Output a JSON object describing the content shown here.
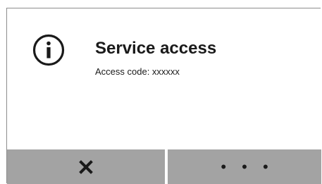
{
  "dialog": {
    "icon": "info-circle-icon",
    "title": "Service access",
    "subtitle": "Access code: xxxxxx"
  },
  "buttons": {
    "cancel_icon": "close-x-icon",
    "more_label": "• • •"
  },
  "colors": {
    "button_background": "#a3a3a3",
    "text": "#1a1a1a",
    "border": "#8c8c8c"
  }
}
